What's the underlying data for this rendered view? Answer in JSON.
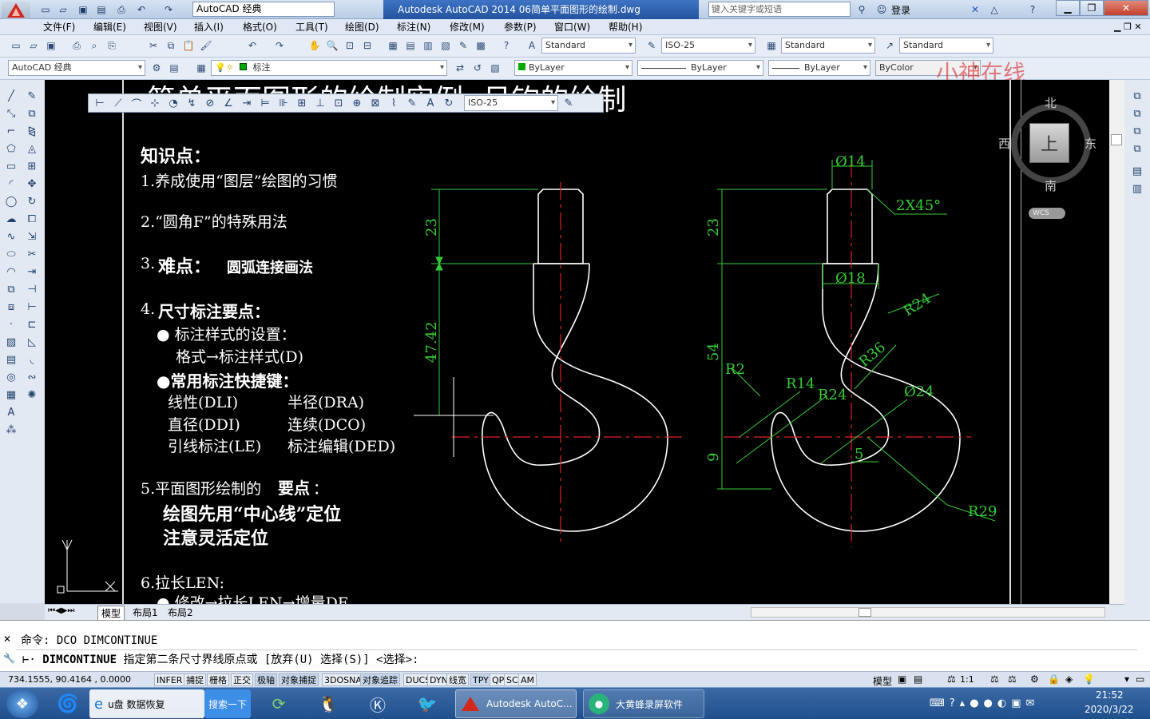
{
  "window": {
    "title": "Autodesk AutoCAD 2014     06简单平面图形的绘制.dwg",
    "workspace": "AutoCAD 经典",
    "search_placeholder": "键入关键字或短语",
    "login": "登录"
  },
  "menu": [
    "文件(F)",
    "编辑(E)",
    "视图(V)",
    "插入(I)",
    "格式(O)",
    "工具(T)",
    "绘图(D)",
    "标注(N)",
    "修改(M)",
    "参数(P)",
    "窗口(W)",
    "帮助(H)"
  ],
  "styles_toolbar": {
    "text_style": "Standard",
    "dim_style": "ISO-25",
    "table_style": "Standard",
    "mleader_style": "Standard"
  },
  "layers_toolbar": {
    "workspace": "AutoCAD 经典",
    "layer": "标注",
    "color": "ByLayer",
    "linetype": "ByLayer",
    "lineweight": "ByLayer",
    "plot_style": "ByColor"
  },
  "floating_dim_toolbar": {
    "dim_style": "ISO-25"
  },
  "watermark": "小神在线",
  "slide": {
    "title": "简单平面图形的绘制实例--吊钩的绘制",
    "heading": "知识点：",
    "items": [
      "1.养成使用“图层”绘图的习惯",
      "2.“圆角F”的特殊用法",
      "3.",
      "难点：",
      "圆弧连接画法",
      "4.",
      "尺寸标注要点：",
      "● 标注样式的设置：",
      "格式→标注样式(D)",
      "●常用标注快捷键：",
      "线性(DLI)",
      "半径(DRA)",
      "直径(DDI)",
      "连续(DCO)",
      "引线标注(LE)",
      "标注编辑(DED)",
      "5.平面图形绘制的",
      "要点",
      "：",
      "绘图先用“中心线”定位",
      "注意灵活定位",
      "6.拉长LEN:",
      "● 修改→拉长LEN→增量DE"
    ]
  },
  "drawing_dims": {
    "left": [
      "23",
      "47.42"
    ],
    "right": [
      "Ø14",
      "2X45°",
      "23",
      "Ø18",
      "R24",
      "54",
      "R36",
      "R2",
      "R14",
      "R24",
      "Ø24",
      "5",
      "9",
      "R29"
    ]
  },
  "viewcube": {
    "north": "北",
    "south": "南",
    "east": "东",
    "west": "西",
    "face": "上",
    "wcs": "WCS"
  },
  "tabs": [
    "模型",
    "布局1",
    "布局2"
  ],
  "command": {
    "history_label": "命令:",
    "history_text": "DCO DIMCONTINUE",
    "prompt_cmd": "DIMCONTINUE",
    "prompt_text": "指定第二条尺寸界线原点或 [放弃(U) 选择(S)] <选择>:"
  },
  "status": {
    "coords": "734.1555, 90.4164 , 0.0000",
    "toggles": [
      "INFER",
      "捕捉",
      "栅格",
      "正交",
      "极轴",
      "对象捕捉",
      "3DOSNAP",
      "对象追踪",
      "DUCS",
      "DYN",
      "线宽",
      "TPY",
      "QP",
      "SC",
      "AM"
    ],
    "model": "模型",
    "scale": "1:1"
  },
  "taskbar": {
    "apps": [
      "u盘 数据恢复",
      "搜索一下",
      "Autodesk AutoC...",
      "大黄蜂录屏软件"
    ],
    "time": "21:52",
    "date": "2020/3/22"
  },
  "colors": {
    "canvas": "#000000",
    "red_text": "#ff2020",
    "dim_green": "#33cc33",
    "center_red": "#e02020"
  }
}
